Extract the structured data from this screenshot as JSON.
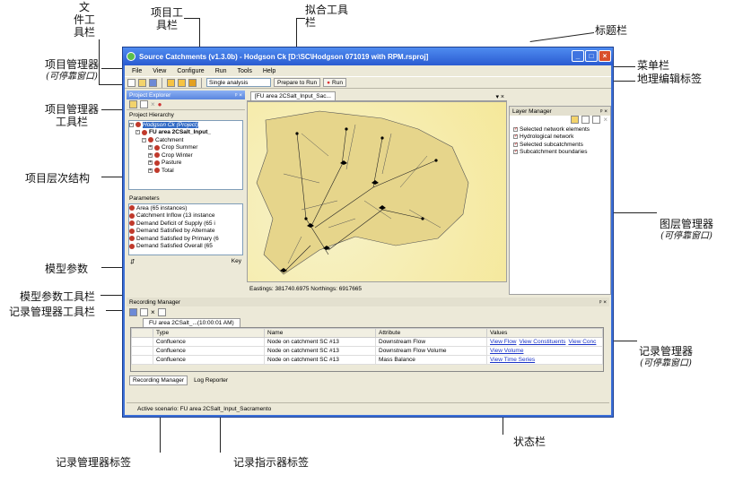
{
  "window": {
    "title": "Source Catchments (v1.3.0b) - Hodgson Ck [D:\\SC\\Hodgson 071019 with RPM.rsproj]",
    "min": "_",
    "max": "□",
    "close": "×"
  },
  "menu": [
    "File",
    "View",
    "Configure",
    "Run",
    "Tools",
    "Help"
  ],
  "toolbar": {
    "analysis": "Single analysis",
    "prepare": "Prepare to Run",
    "run": "Run"
  },
  "explorer": {
    "title": "Project Explorer",
    "hierarchy_label": "Project Hierarchy",
    "tree": [
      "Hodgson Ck (Project)",
      "FU area 2CSalt_Input_",
      "Catchment",
      "Crop Summer",
      "Crop Winter",
      "Pasture",
      "Total"
    ],
    "params_label": "Parameters",
    "params": [
      "Area (65 instances)",
      "Catchment Inflow (13 instance",
      "Demand Deficit of Supply (65 i",
      "Demand Satisfied by Alternate",
      "Demand Satisfied by Primary (6",
      "Demand Satisfied Overall (65"
    ],
    "key": "Key"
  },
  "map": {
    "tab": "[FU area 2CSalt_Input_Sac...",
    "coords": "Eastings: 381740.6975 Northings: 6917665"
  },
  "layers": {
    "title": "Layer Manager",
    "items": [
      "Selected network elements",
      "Hydrological network",
      "Selected subcatchments",
      "Subcatchment boundaries"
    ]
  },
  "recorder": {
    "title": "Recording Manager",
    "tab": "FU area 2CSalt_...(10:00:01 AM)",
    "columns": [
      "Type",
      "Name",
      "Attribute",
      "Values"
    ],
    "rows": [
      {
        "type": "Confluence",
        "name": "Node on catchment SC #13",
        "attr": "Downstream Flow",
        "values": [
          "View Flow",
          "View Constituents",
          "View Conc"
        ]
      },
      {
        "type": "Confluence",
        "name": "Node on catchment SC #13",
        "attr": "Downstream Flow Volume",
        "values": [
          "View Volume"
        ]
      },
      {
        "type": "Confluence",
        "name": "Node on catchment SC #13",
        "attr": "Mass Balance",
        "values": [
          "View Time Series"
        ]
      }
    ],
    "bottom_tabs": [
      "Recording Manager",
      "Log Reporter"
    ]
  },
  "status": "Active scenario: FU area 2CSalt_Input_Sacramento",
  "annotations": {
    "file_tb": "文\n件工\n具栏",
    "proj_tb": "项目工\n具栏",
    "fit_tb": "拟合工具\n栏",
    "titlebar": "标题栏",
    "menubar": "菜单栏",
    "geo_tab": "地理编辑标签",
    "pm": "项目管理器",
    "pm_sub": "(可停靠窗口)",
    "pm_tb": "项目管理器\n工具栏",
    "hier": "项目层次结构",
    "params": "模型参数",
    "params_tb": "模型参数工具栏",
    "rec_tb": "记录管理器工具栏",
    "layer": "图层管理器",
    "layer_sub": "(可停靠窗口)",
    "rec": "记录管理器",
    "rec_sub": "(可停靠窗口)",
    "status": "状态栏",
    "rec_tab": "记录管理器标签",
    "log_tab": "记录指示器标签"
  }
}
